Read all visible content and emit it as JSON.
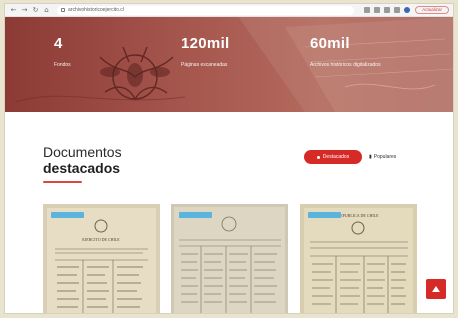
{
  "browser": {
    "url": "archivohistoricoejercito.cl",
    "update_label": "Actualizar"
  },
  "hero": {
    "stats": [
      {
        "value": "4",
        "label": "Fondos"
      },
      {
        "value": "120mil",
        "label": "Páginas escaneadas"
      },
      {
        "value": "60mil",
        "label": "Archivos históricos digitalizados"
      }
    ]
  },
  "section": {
    "title_line1": "Documentos",
    "title_line2": "destacados",
    "filters": [
      {
        "label": "Destacados",
        "active": true
      },
      {
        "label": "Populares",
        "active": false
      }
    ]
  },
  "cards": [
    {
      "heading": "EJERCITO DE CHILE",
      "badge_color": "#5bb4dd"
    },
    {
      "heading": "",
      "badge_color": "#5bb4dd"
    },
    {
      "heading": "REPUBLICA DE CHILE",
      "badge_color": "#5bb4dd"
    }
  ],
  "colors": {
    "accent": "#d62a27",
    "hero": "#a5564d",
    "badge": "#5bb4dd"
  }
}
